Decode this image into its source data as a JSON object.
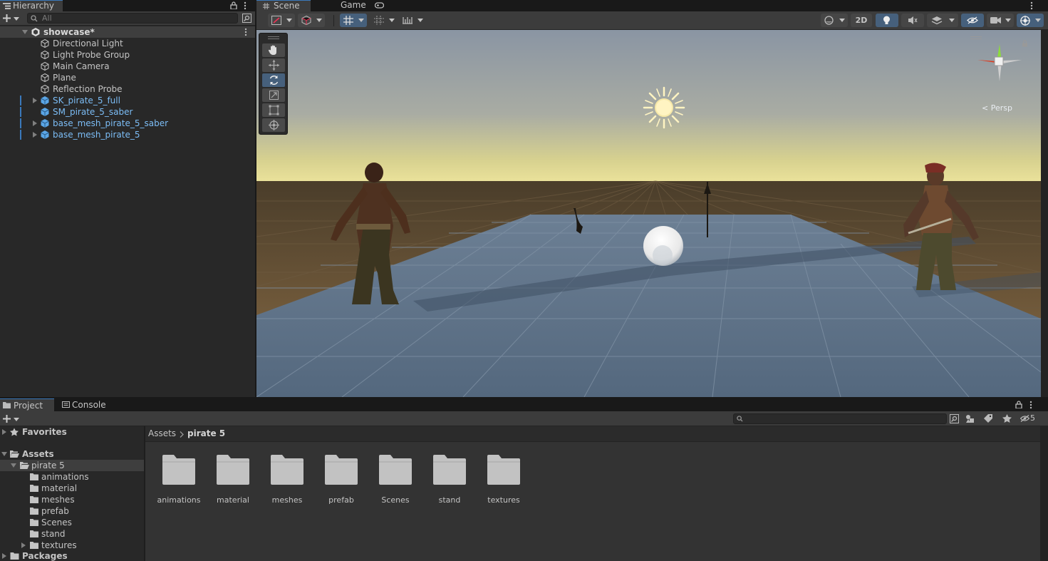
{
  "hierarchy": {
    "tab_label": "Hierarchy",
    "search_placeholder": "All",
    "scene_name": "showcase*",
    "items": [
      {
        "label": "Directional Light",
        "prefab": false,
        "expandable": false
      },
      {
        "label": "Light Probe Group",
        "prefab": false,
        "expandable": false
      },
      {
        "label": "Main Camera",
        "prefab": false,
        "expandable": false
      },
      {
        "label": "Plane",
        "prefab": false,
        "expandable": false
      },
      {
        "label": "Reflection Probe",
        "prefab": false,
        "expandable": false
      },
      {
        "label": "SK_pirate_5_full",
        "prefab": true,
        "expandable": true
      },
      {
        "label": "SM_pirate_5_saber",
        "prefab": true,
        "expandable": false
      },
      {
        "label": "base_mesh_pirate_5_saber",
        "prefab": true,
        "expandable": true
      },
      {
        "label": "base_mesh_pirate_5",
        "prefab": true,
        "expandable": true
      }
    ]
  },
  "scene_view": {
    "tabs": [
      "Scene",
      "Game"
    ],
    "active_tab": "Scene",
    "toolbar": {
      "mode_2d_label": "2D",
      "hidden_count": ""
    },
    "tools": [
      "hand-tool",
      "move-tool",
      "rotate-tool",
      "scale-tool",
      "rect-tool",
      "transform-tool"
    ],
    "selected_tool": "rotate-tool",
    "gizmo_label": "< Persp",
    "colors": {
      "sky_top": "#8c98a6",
      "horizon": "#e3dc9c",
      "ground": "#6b5536",
      "plane": "#5c7289",
      "selection": "#46607c"
    }
  },
  "project": {
    "tabs": [
      "Project",
      "Console"
    ],
    "active_tab": "Project",
    "hidden_count": "5",
    "tree": {
      "favorites": "Favorites",
      "assets": "Assets",
      "selected_folder": "pirate 5",
      "subfolders": [
        "animations",
        "material",
        "meshes",
        "prefab",
        "Scenes",
        "stand",
        "textures"
      ],
      "packages": "Packages"
    },
    "breadcrumb": [
      "Assets",
      "pirate 5"
    ],
    "folders": [
      "animations",
      "material",
      "meshes",
      "prefab",
      "Scenes",
      "stand",
      "textures"
    ]
  }
}
